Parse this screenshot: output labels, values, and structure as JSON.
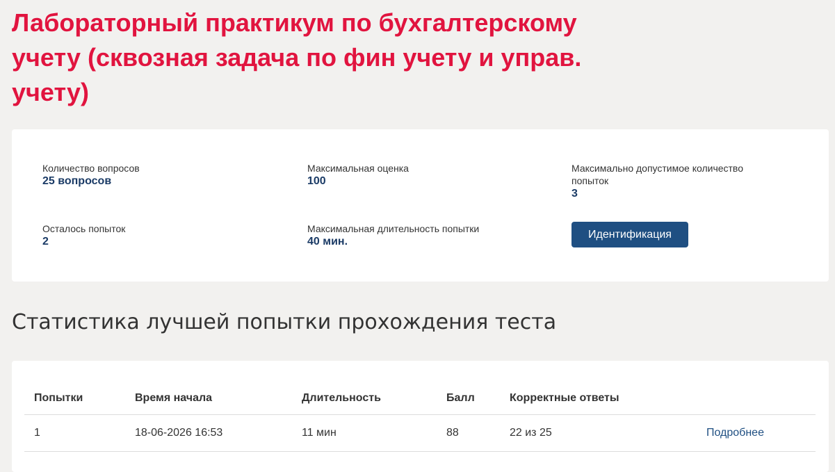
{
  "page_title": "Лабораторный практикум по бухгалтерскому учету (сквозная задача по фин учету и управ. учету)",
  "info": {
    "questions_label": "Количество вопросов",
    "questions_value": "25 вопросов",
    "max_score_label": "Максимальная оценка",
    "max_score_value": "100",
    "max_attempts_label": "Максимально допустимое количество попыток",
    "max_attempts_value": "3",
    "remaining_label": "Осталось попыток",
    "remaining_value": "2",
    "max_duration_label": "Максимальная длительность попытки",
    "max_duration_value": "40 мин.",
    "ident_button": "Идентификация"
  },
  "stats": {
    "title": "Статистика лучшей попытки прохождения теста",
    "columns": [
      "Попытки",
      "Время начала",
      "Длительность",
      "Балл",
      "Корректные ответы",
      ""
    ],
    "rows": [
      {
        "attempt": "1",
        "start_time": "18-06-2026 16:53",
        "duration": "11 мин",
        "score": "88",
        "correct": "22 из 25",
        "details_link": "Подробнее"
      }
    ]
  },
  "colors": {
    "title": "#e1143f",
    "accent": "#1f4f82",
    "value_text": "#1b3b66",
    "background": "#f2f1ef"
  }
}
